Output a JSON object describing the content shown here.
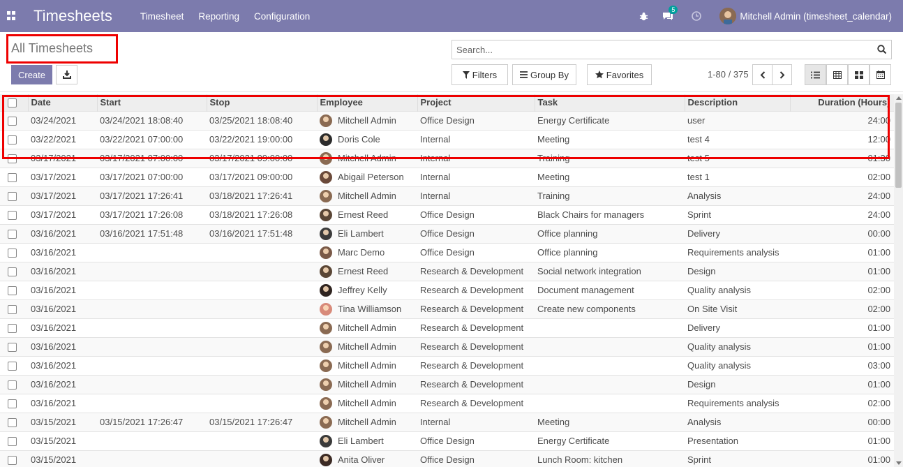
{
  "navbar": {
    "brand": "Timesheets",
    "menu": [
      "Timesheet",
      "Reporting",
      "Configuration"
    ],
    "messages_count": "5",
    "user_name": "Mitchell Admin (timesheet_calendar)"
  },
  "control_panel": {
    "title": "All Timesheets",
    "create_label": "Create",
    "search_placeholder": "Search...",
    "filters_label": "Filters",
    "group_by_label": "Group By",
    "favorites_label": "Favorites",
    "pager": "1-80 / 375"
  },
  "colors": {
    "navbar": "#7c7bad",
    "highlight": "#ee0000"
  },
  "table": {
    "columns": [
      "Date",
      "Start",
      "Stop",
      "Employee",
      "Project",
      "Task",
      "Description",
      "Duration (Hours)"
    ],
    "rows": [
      {
        "date": "03/24/2021",
        "start": "03/24/2021 18:08:40",
        "stop": "03/25/2021 18:08:40",
        "employee": "Mitchell Admin",
        "avatar": "#8a6a52",
        "project": "Office Design",
        "task": "Energy Certificate",
        "description": "user",
        "duration": "24:00"
      },
      {
        "date": "03/22/2021",
        "start": "03/22/2021 07:00:00",
        "stop": "03/22/2021 19:00:00",
        "employee": "Doris Cole",
        "avatar": "#2b2b2b",
        "project": "Internal",
        "task": "Meeting",
        "description": "test 4",
        "duration": "12:00"
      },
      {
        "date": "03/17/2021",
        "start": "03/17/2021 07:00:00",
        "stop": "03/17/2021 09:00:00",
        "employee": "Mitchell Admin",
        "avatar": "#8a6a52",
        "project": "Internal",
        "task": "Training",
        "description": "test 5",
        "duration": "01:30"
      },
      {
        "date": "03/17/2021",
        "start": "03/17/2021 07:00:00",
        "stop": "03/17/2021 09:00:00",
        "employee": "Abigail Peterson",
        "avatar": "#6b4a3a",
        "project": "Internal",
        "task": "Meeting",
        "description": "test 1",
        "duration": "02:00"
      },
      {
        "date": "03/17/2021",
        "start": "03/17/2021 17:26:41",
        "stop": "03/18/2021 17:26:41",
        "employee": "Mitchell Admin",
        "avatar": "#8a6a52",
        "project": "Internal",
        "task": "Training",
        "description": "Analysis",
        "duration": "24:00"
      },
      {
        "date": "03/17/2021",
        "start": "03/17/2021 17:26:08",
        "stop": "03/18/2021 17:26:08",
        "employee": "Ernest Reed",
        "avatar": "#5a4636",
        "project": "Office Design",
        "task": "Black Chairs for managers",
        "description": "Sprint",
        "duration": "24:00"
      },
      {
        "date": "03/16/2021",
        "start": "03/16/2021 17:51:48",
        "stop": "03/16/2021 17:51:48",
        "employee": "Eli Lambert",
        "avatar": "#3a3a3a",
        "project": "Office Design",
        "task": "Office planning",
        "description": "Delivery",
        "duration": "00:00"
      },
      {
        "date": "03/16/2021",
        "start": "",
        "stop": "",
        "employee": "Marc Demo",
        "avatar": "#7a5a48",
        "project": "Office Design",
        "task": "Office planning",
        "description": "Requirements analysis",
        "duration": "01:00"
      },
      {
        "date": "03/16/2021",
        "start": "",
        "stop": "",
        "employee": "Ernest Reed",
        "avatar": "#5a4636",
        "project": "Research & Development",
        "task": "Social network integration",
        "description": "Design",
        "duration": "01:00"
      },
      {
        "date": "03/16/2021",
        "start": "",
        "stop": "",
        "employee": "Jeffrey Kelly",
        "avatar": "#2f2420",
        "project": "Research & Development",
        "task": "Document management",
        "description": "Quality analysis",
        "duration": "02:00"
      },
      {
        "date": "03/16/2021",
        "start": "",
        "stop": "",
        "employee": "Tina Williamson",
        "avatar": "#d88a7a",
        "project": "Research & Development",
        "task": "Create new components",
        "description": "On Site Visit",
        "duration": "02:00"
      },
      {
        "date": "03/16/2021",
        "start": "",
        "stop": "",
        "employee": "Mitchell Admin",
        "avatar": "#8a6a52",
        "project": "Research & Development",
        "task": "",
        "description": "Delivery",
        "duration": "01:00"
      },
      {
        "date": "03/16/2021",
        "start": "",
        "stop": "",
        "employee": "Mitchell Admin",
        "avatar": "#8a6a52",
        "project": "Research & Development",
        "task": "",
        "description": "Quality analysis",
        "duration": "01:00"
      },
      {
        "date": "03/16/2021",
        "start": "",
        "stop": "",
        "employee": "Mitchell Admin",
        "avatar": "#8a6a52",
        "project": "Research & Development",
        "task": "",
        "description": "Quality analysis",
        "duration": "03:00"
      },
      {
        "date": "03/16/2021",
        "start": "",
        "stop": "",
        "employee": "Mitchell Admin",
        "avatar": "#8a6a52",
        "project": "Research & Development",
        "task": "",
        "description": "Design",
        "duration": "01:00"
      },
      {
        "date": "03/16/2021",
        "start": "",
        "stop": "",
        "employee": "Mitchell Admin",
        "avatar": "#8a6a52",
        "project": "Research & Development",
        "task": "",
        "description": "Requirements analysis",
        "duration": "02:00"
      },
      {
        "date": "03/15/2021",
        "start": "03/15/2021 17:26:47",
        "stop": "03/15/2021 17:26:47",
        "employee": "Mitchell Admin",
        "avatar": "#8a6a52",
        "project": "Internal",
        "task": "Meeting",
        "description": "Analysis",
        "duration": "00:00"
      },
      {
        "date": "03/15/2021",
        "start": "",
        "stop": "",
        "employee": "Eli Lambert",
        "avatar": "#3a3a3a",
        "project": "Office Design",
        "task": "Energy Certificate",
        "description": "Presentation",
        "duration": "01:00"
      },
      {
        "date": "03/15/2021",
        "start": "",
        "stop": "",
        "employee": "Anita Oliver",
        "avatar": "#3b2a24",
        "project": "Office Design",
        "task": "Lunch Room: kitchen",
        "description": "Sprint",
        "duration": "01:00"
      }
    ]
  }
}
